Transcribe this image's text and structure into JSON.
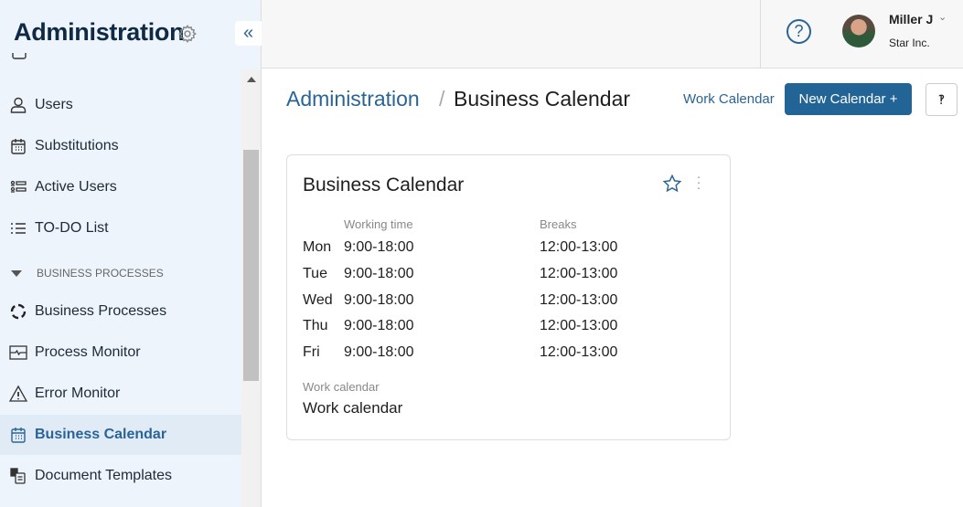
{
  "sidebar": {
    "title": "Administration",
    "items_top": [
      {
        "label": "Users",
        "icon": "user-icon"
      },
      {
        "label": "Substitutions",
        "icon": "calendar-icon"
      },
      {
        "label": "Active Users",
        "icon": "active-users-icon"
      },
      {
        "label": "TO-DO List",
        "icon": "list-icon"
      }
    ],
    "section": "BUSINESS PROCESSES",
    "items": [
      {
        "label": "Business Processes",
        "icon": "cycle-icon"
      },
      {
        "label": "Process Monitor",
        "icon": "monitor-icon"
      },
      {
        "label": "Error Monitor",
        "icon": "warning-icon"
      },
      {
        "label": "Business Calendar",
        "icon": "calendar-icon",
        "active": true
      },
      {
        "label": "Document Templates",
        "icon": "document-icon"
      }
    ]
  },
  "header": {
    "user_name": "Miller J",
    "company": "Star Inc."
  },
  "breadcrumb": {
    "root": "Administration",
    "separator": "/",
    "current": "Business Calendar"
  },
  "toolbar": {
    "work_calendar": "Work Calendar",
    "new_calendar": "New Calendar +"
  },
  "card": {
    "title": "Business Calendar",
    "col_working": "Working time",
    "col_breaks": "Breaks",
    "rows": [
      {
        "day": "Mon",
        "work": "9:00-18:00",
        "break": "12:00-13:00"
      },
      {
        "day": "Tue",
        "work": "9:00-18:00",
        "break": "12:00-13:00"
      },
      {
        "day": "Wed",
        "work": "9:00-18:00",
        "break": "12:00-13:00"
      },
      {
        "day": "Thu",
        "work": "9:00-18:00",
        "break": "12:00-13:00"
      },
      {
        "day": "Fri",
        "work": "9:00-18:00",
        "break": "12:00-13:00"
      }
    ],
    "work_calendar_label": "Work calendar",
    "work_calendar_value": "Work calendar"
  },
  "colors": {
    "accent": "#2a6496",
    "button": "#236496",
    "sidebar_bg": "#eef4fc"
  }
}
